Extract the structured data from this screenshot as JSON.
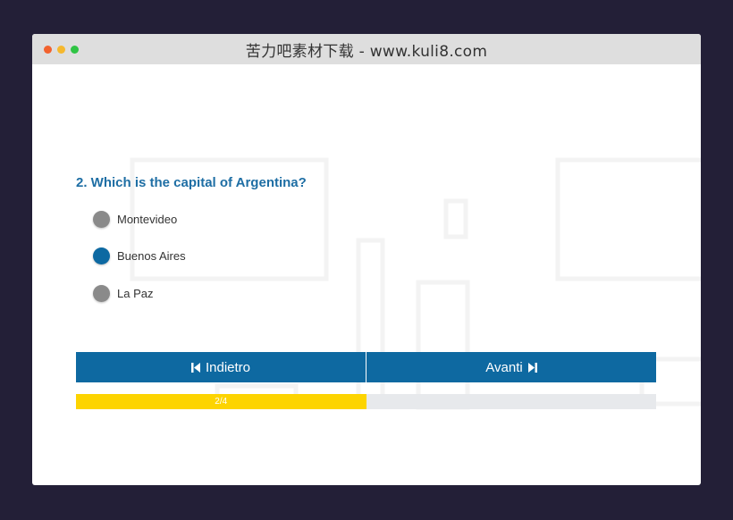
{
  "window": {
    "title": "苦力吧素材下载 - www.kuli8.com",
    "controls": [
      "close-dot",
      "minimize-dot",
      "maximize-dot"
    ]
  },
  "quiz": {
    "question": "2. Which is the capital of Argentina?",
    "options": [
      {
        "label": "Montevideo",
        "selected": false
      },
      {
        "label": "Buenos Aires",
        "selected": true
      },
      {
        "label": "La Paz",
        "selected": false
      }
    ],
    "prev_label": "Indietro",
    "next_label": "Avanti",
    "progress": {
      "text": "2/4",
      "value": 0.5
    }
  },
  "colors": {
    "background": "#231f37",
    "accent": "#0e69a1",
    "question_text": "#1e6ea4",
    "progress_fill": "#fdd400",
    "progress_track": "#e7e9ec",
    "radio_unselected": "#8a8a8a",
    "radio_selected": "#0d69a2"
  },
  "icons": {
    "prev": "skip-previous-icon",
    "next": "skip-next-icon"
  }
}
